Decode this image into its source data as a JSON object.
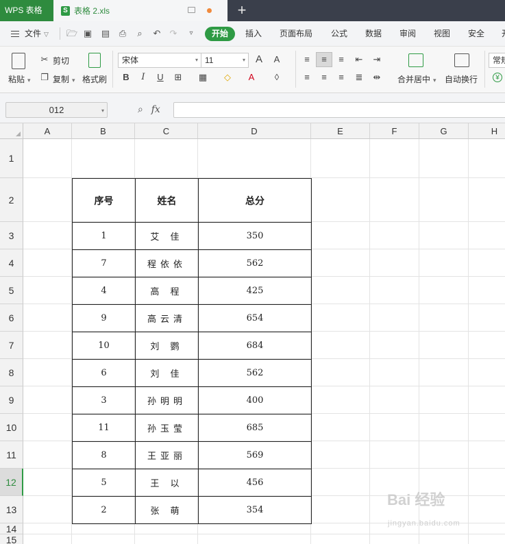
{
  "titlebar": {
    "app_name": "WPS 表格",
    "doc_icon": "S",
    "doc_name": "表格 2.xls",
    "new_tab": "+"
  },
  "menu": {
    "file": "文件",
    "tabs": [
      "开始",
      "插入",
      "页面布局",
      "公式",
      "数据",
      "审阅",
      "视图",
      "安全",
      "开"
    ]
  },
  "ribbon": {
    "paste": "粘贴",
    "cut": "剪切",
    "copy": "复制",
    "format_painter": "格式刷",
    "font_name": "宋体",
    "font_size": "11",
    "merge_center": "合并居中",
    "wrap_text": "自动换行",
    "number_format": "常规"
  },
  "formula_bar": {
    "cell_ref": "012",
    "fx_label": "fx",
    "value": ""
  },
  "grid": {
    "columns": [
      "A",
      "B",
      "C",
      "D",
      "E",
      "F",
      "G",
      "H"
    ],
    "rows": [
      "1",
      "2",
      "3",
      "4",
      "5",
      "6",
      "7",
      "8",
      "9",
      "10",
      "11",
      "12",
      "13",
      "14",
      "15"
    ],
    "active_row": "12"
  },
  "table": {
    "headers": [
      "序号",
      "姓名",
      "总分"
    ],
    "rows": [
      [
        "1",
        "艾 佳",
        "350"
      ],
      [
        "7",
        "程依依",
        "562"
      ],
      [
        "4",
        "高 程",
        "425"
      ],
      [
        "9",
        "高云清",
        "654"
      ],
      [
        "10",
        "刘 鹦",
        "684"
      ],
      [
        "6",
        "刘 佳",
        "562"
      ],
      [
        "3",
        "孙明明",
        "400"
      ],
      [
        "11",
        "孙玉莹",
        "685"
      ],
      [
        "8",
        "王亚丽",
        "569"
      ],
      [
        "5",
        "王 以",
        "456"
      ],
      [
        "2",
        "张 萌",
        "354"
      ]
    ]
  },
  "watermark": {
    "brand": "Bai 经验",
    "url": "jingyan.baidu.com"
  },
  "colors": {
    "accent": "#2e9a44",
    "titlebar": "#3a3f4b"
  }
}
